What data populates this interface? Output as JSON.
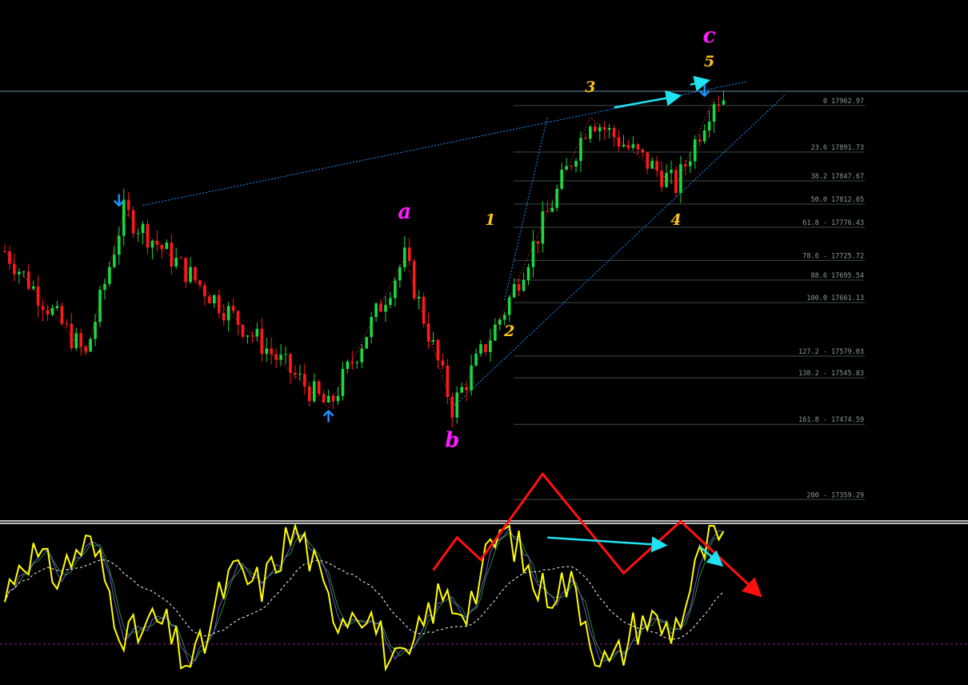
{
  "colors": {
    "background": "#000000",
    "bull_candle": "#19d93f",
    "bear_candle": "#ff1a1a",
    "fib_line": "#3c4c4c",
    "fib_text": "#8a9a9a",
    "trendline": "#1e90ff",
    "price_line": "#6e8fa8",
    "wave_major": "#ff1aff",
    "wave_minor": "#ffc21a",
    "signal_arrow": "#1e90ff",
    "divergence_arrow": "#20e3f2",
    "zigzag": "#b02020",
    "oscillator_main": "#ffff00",
    "oscillator_fast": "#6b5bd6",
    "oscillator_slow": "#2e8b2e",
    "oscillator_signal": "#ffffff",
    "oscillator_level": "#8c2a8c",
    "pattern_arrow": "#ff1010"
  },
  "chart_data": [
    {
      "type": "candlestick",
      "panel": "price",
      "y_range": [
        17340,
        18110
      ],
      "fibonacci_levels": [
        {
          "ratio": 0,
          "price": 17962.97,
          "label": "0 17962.97"
        },
        {
          "ratio": 23.6,
          "price": 17891.73,
          "label": "23.6 17891.73"
        },
        {
          "ratio": 38.2,
          "price": 17847.67,
          "label": "38.2 17847.67"
        },
        {
          "ratio": 50.0,
          "price": 17812.05,
          "label": "50.0 17812.05"
        },
        {
          "ratio": 61.8,
          "price": 17776.43,
          "label": "61.8 - 17776.43"
        },
        {
          "ratio": 78.6,
          "price": 17725.72,
          "label": "78.6 - 17725.72"
        },
        {
          "ratio": 88.6,
          "price": 17695.54,
          "label": "88.6 17695.54"
        },
        {
          "ratio": 100.0,
          "price": 17661.13,
          "label": "100.0 17661.13"
        },
        {
          "ratio": 127.2,
          "price": 17579.03,
          "label": "127.2 - 17579.03"
        },
        {
          "ratio": 138.2,
          "price": 17545.83,
          "label": "138.2 - 17545.83"
        },
        {
          "ratio": 161.8,
          "price": 17474.59,
          "label": "161.8 - 17474.59"
        },
        {
          "ratio": 200,
          "price": 17359.29,
          "label": "200 - 17359.29"
        }
      ],
      "wave_labels": [
        {
          "text": "a",
          "bar": 84,
          "price": 17790,
          "kind": "major"
        },
        {
          "text": "b",
          "bar": 94,
          "price": 17440,
          "kind": "major"
        },
        {
          "text": "c",
          "bar": 148,
          "price": 18060,
          "kind": "major"
        },
        {
          "text": "1",
          "bar": 102,
          "price": 17780,
          "kind": "minor"
        },
        {
          "text": "2",
          "bar": 106,
          "price": 17610,
          "kind": "minor"
        },
        {
          "text": "3",
          "bar": 123,
          "price": 17984,
          "kind": "minor"
        },
        {
          "text": "4",
          "bar": 141,
          "price": 17780,
          "kind": "minor"
        },
        {
          "text": "5",
          "bar": 148,
          "price": 18023,
          "kind": "minor"
        }
      ],
      "zigzag_points": [
        {
          "bar": 0,
          "price": 17740
        },
        {
          "bar": 17,
          "price": 17580
        },
        {
          "bar": 25,
          "price": 17800
        },
        {
          "bar": 68,
          "price": 17500
        },
        {
          "bar": 84,
          "price": 17730
        },
        {
          "bar": 94,
          "price": 17500
        },
        {
          "bar": 105,
          "price": 17650
        },
        {
          "bar": 123,
          "price": 17945
        },
        {
          "bar": 141,
          "price": 17840
        },
        {
          "bar": 149,
          "price": 17975
        }
      ],
      "signal_arrows": [
        {
          "bar": 24,
          "price": 17810,
          "direction": "down"
        },
        {
          "bar": 68,
          "price": 17495,
          "direction": "up"
        },
        {
          "bar": 147,
          "price": 17978,
          "direction": "down"
        }
      ],
      "trendlines": [
        {
          "from": {
            "bar": 29,
            "price": 17810
          },
          "to": {
            "bar": 156,
            "price": 18000
          }
        },
        {
          "from": {
            "bar": 94,
            "price": 17500
          },
          "to": {
            "bar": 164,
            "price": 17980
          }
        },
        {
          "from": {
            "bar": 105,
            "price": 17665
          },
          "to": {
            "bar": 114,
            "price": 17945
          }
        }
      ],
      "current_price": 17985,
      "price_divergence_arrows": [
        {
          "from": {
            "bar": 128,
            "price": 17960
          },
          "to": {
            "bar": 141,
            "price": 17977
          }
        },
        {
          "from": {
            "bar": 144,
            "price": 17995
          },
          "to": {
            "bar": 147,
            "price": 18000
          }
        }
      ]
    },
    {
      "type": "line",
      "panel": "oscillator",
      "y_range": [
        0,
        100
      ],
      "levels": [
        20
      ],
      "series_colors": [
        "#ffff00",
        "#6b5bd6",
        "#2e8b2e",
        "#ffffff"
      ],
      "divergence_arrows": [
        {
          "from": {
            "bar": 114,
            "value": 92
          },
          "to": {
            "bar": 138,
            "value": 87
          }
        },
        {
          "from": {
            "bar": 146,
            "value": 86
          },
          "to": {
            "bar": 150,
            "value": 75
          }
        }
      ],
      "pattern_arrow_points": [
        {
          "bar": 90,
          "value": 70
        },
        {
          "bar": 95,
          "value": 92
        },
        {
          "bar": 100,
          "value": 77
        },
        {
          "bar": 113,
          "value": 135
        },
        {
          "bar": 130,
          "value": 68
        },
        {
          "bar": 142,
          "value": 103
        },
        {
          "bar": 158,
          "value": 55
        }
      ]
    }
  ]
}
